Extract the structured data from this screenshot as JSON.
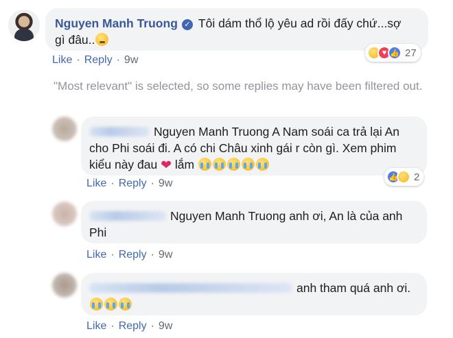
{
  "main_comment": {
    "author": "Nguyen Manh Truong",
    "text_line1": "Tôi dám thổ lộ yêu ad rồi đấy chứ...sợ",
    "text_line2": "gì đâu..",
    "like": "Like",
    "reply": "Reply",
    "age": "9w",
    "reaction_count": "27",
    "reactions": [
      "haha",
      "love",
      "like"
    ]
  },
  "filter_notice": "\"Most relevant\" is selected, so some replies may have been filtered out.",
  "replies": [
    {
      "mention": "Nguyen Manh Truong",
      "line1": "A Nam soái ca trả lại An",
      "line2": "cho Phi soái đi. A có chi Châu xinh gái r còn gì. Xem phim",
      "line3_pre": "kiểu này đau",
      "line3_post": "lắm",
      "like": "Like",
      "reply": "Reply",
      "age": "9w",
      "reaction_count": "2",
      "reactions": [
        "like",
        "haha"
      ]
    },
    {
      "mention": "Nguyen Manh Truong",
      "line1": "anh ơi, An là của anh",
      "line2": "Phi",
      "like": "Like",
      "reply": "Reply",
      "age": "9w"
    },
    {
      "line1": "anh tham quá anh ơi.",
      "like": "Like",
      "reply": "Reply",
      "age": "9w"
    }
  ],
  "colors": {
    "link": "#385898",
    "action": "#4267b2",
    "bubble": "#f2f3f5",
    "muted": "#90949c"
  }
}
